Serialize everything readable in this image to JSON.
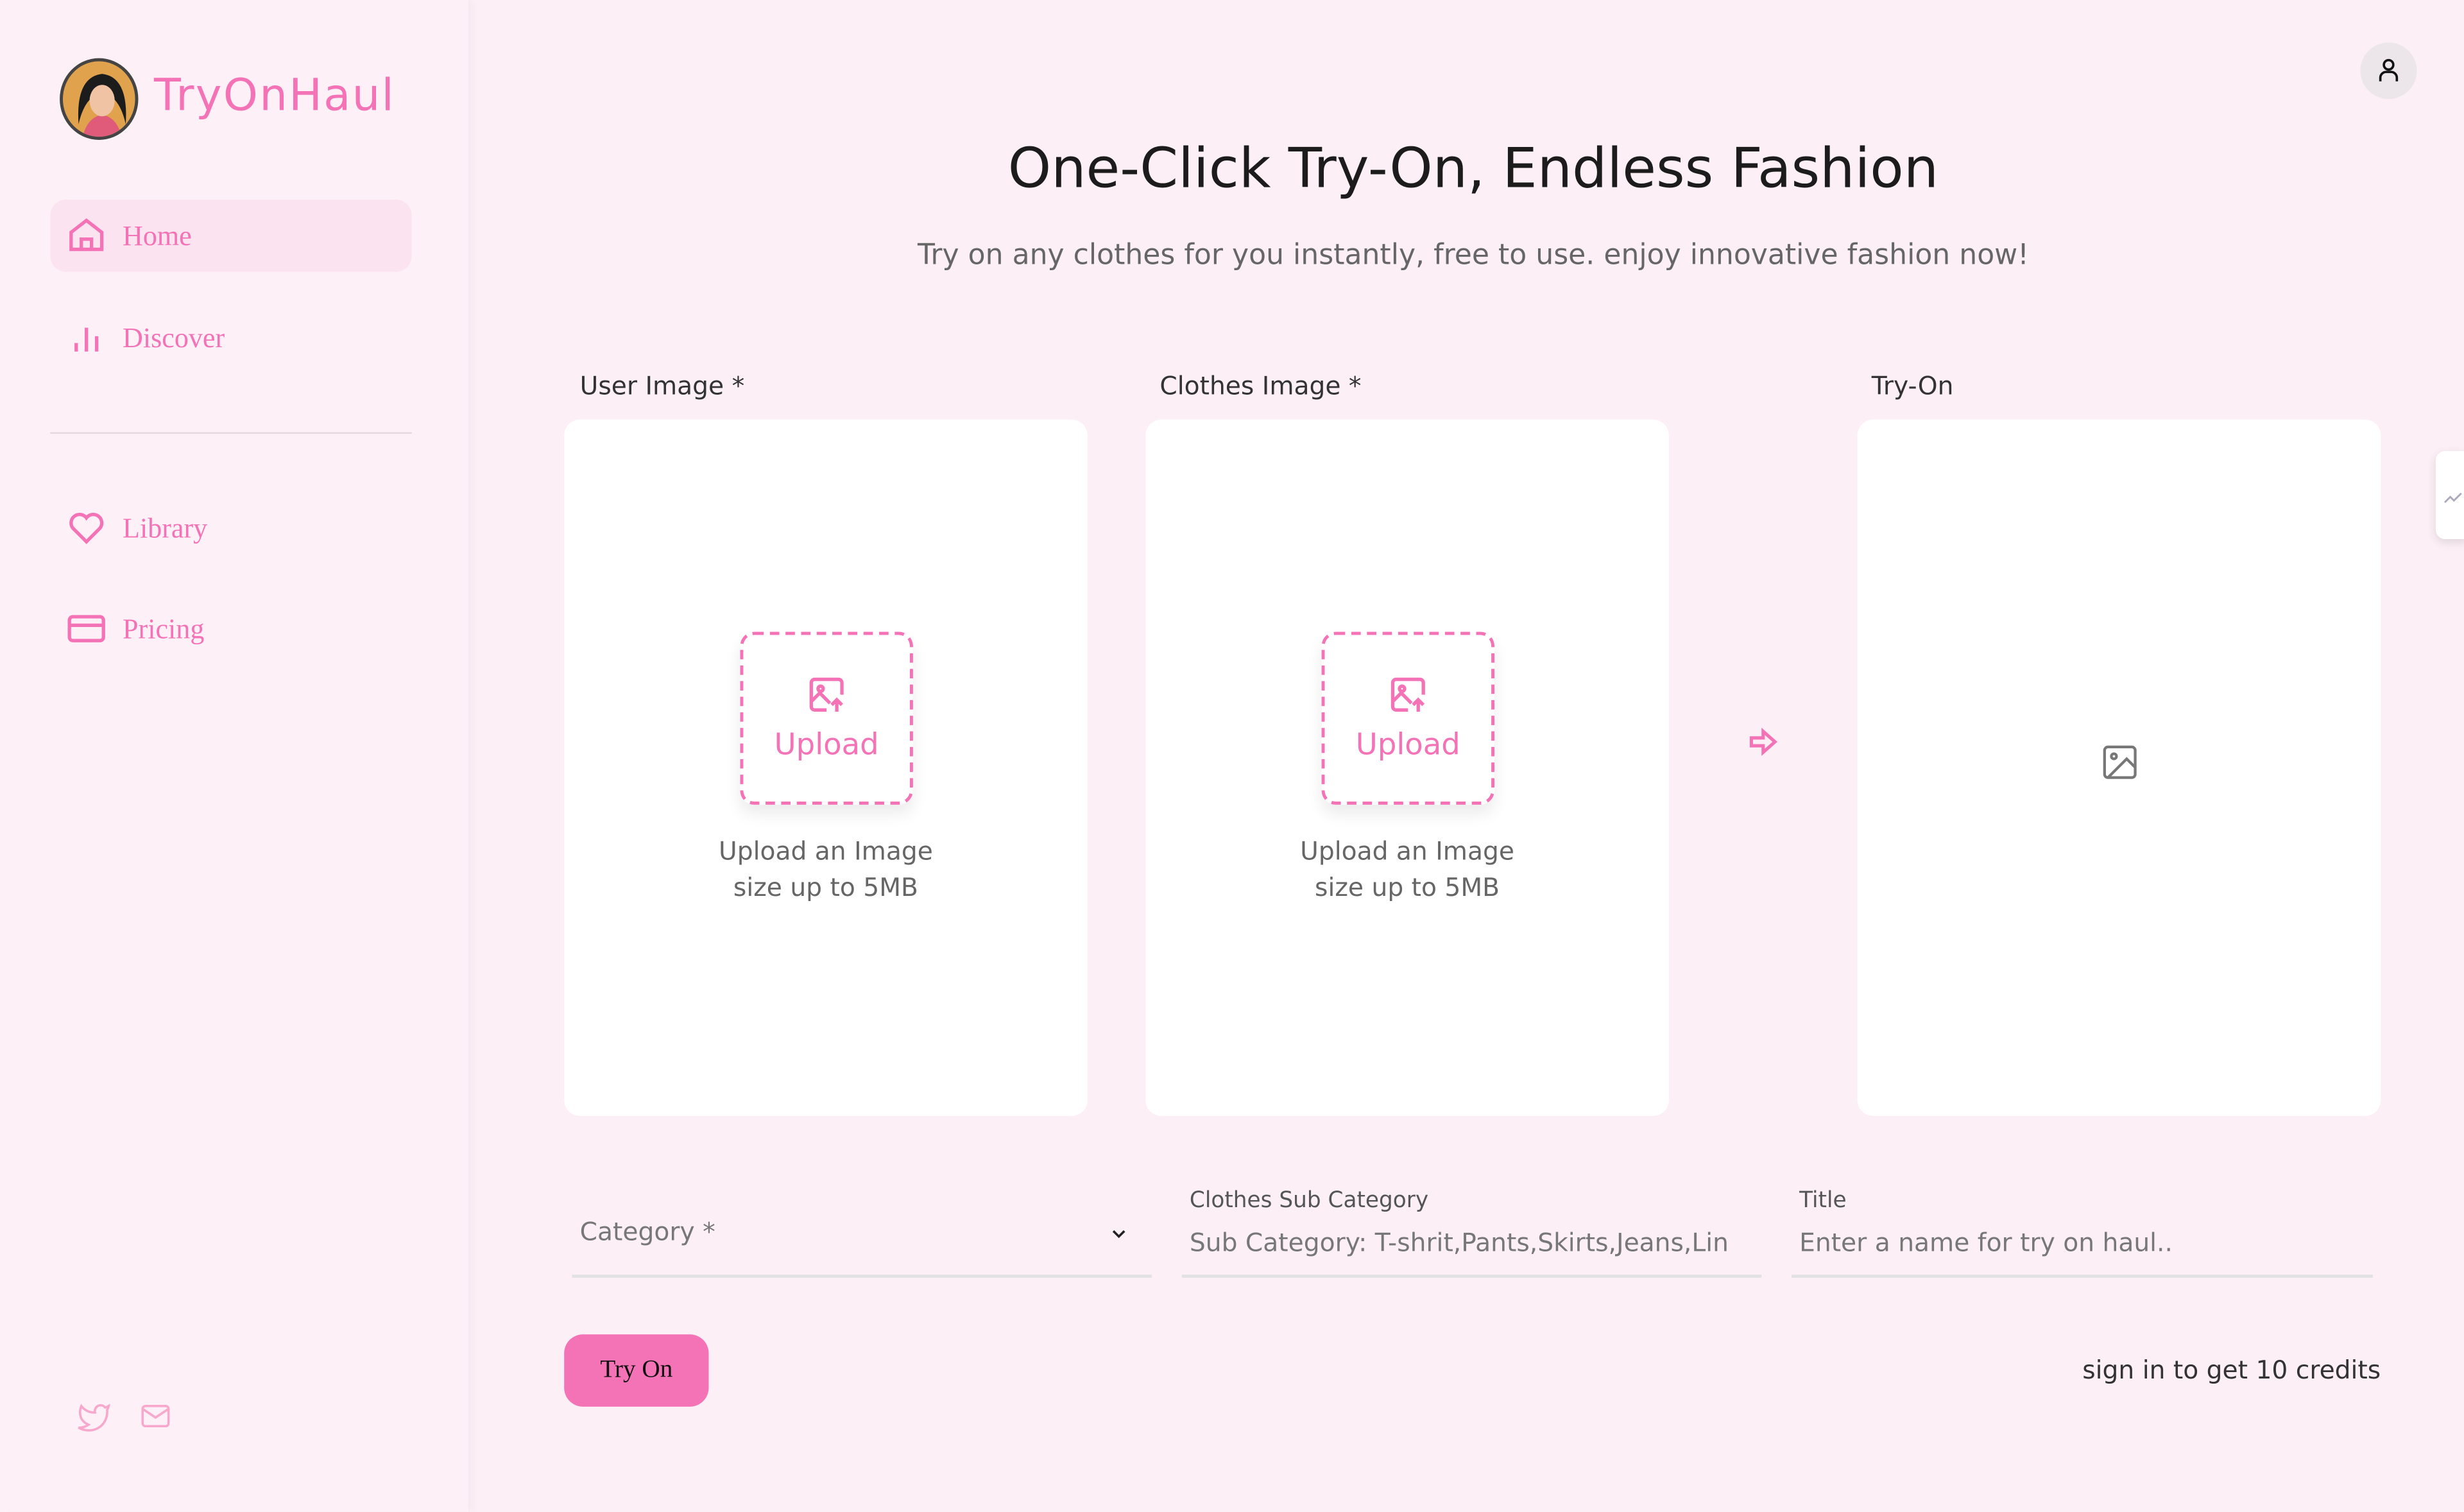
{
  "brand": {
    "name": "TryOnHaul",
    "accent": "#f472b6"
  },
  "sidebar": {
    "items": [
      {
        "label": "Home",
        "icon": "home-icon",
        "active": true
      },
      {
        "label": "Discover",
        "icon": "bar-chart-icon"
      },
      {
        "label": "Library",
        "icon": "heart-icon"
      },
      {
        "label": "Pricing",
        "icon": "credit-card-icon"
      }
    ],
    "social": [
      "twitter-icon",
      "mail-icon"
    ]
  },
  "header": {
    "title": "One-Click Try-On, Endless Fashion",
    "subtitle": "Try on any clothes for you instantly, free to use. enjoy innovative fashion now!"
  },
  "panels": {
    "user": {
      "label": "User Image *",
      "upload": "Upload",
      "hint1": "Upload an Image",
      "hint2": "size up to 5MB"
    },
    "clothes": {
      "label": "Clothes Image *",
      "upload": "Upload",
      "hint1": "Upload an Image",
      "hint2": "size up to 5MB"
    },
    "result": {
      "label": "Try-On"
    }
  },
  "form": {
    "category": {
      "placeholder": "Category *"
    },
    "subcategory": {
      "label": "Clothes Sub Category",
      "placeholder": "Sub Category: T-shrit,Pants,Skirts,Jeans,Lin"
    },
    "title": {
      "label": "Title",
      "placeholder": "Enter a name for try on haul.."
    }
  },
  "actions": {
    "try_on": "Try On",
    "credits_note": "sign in to get 10 credits"
  }
}
